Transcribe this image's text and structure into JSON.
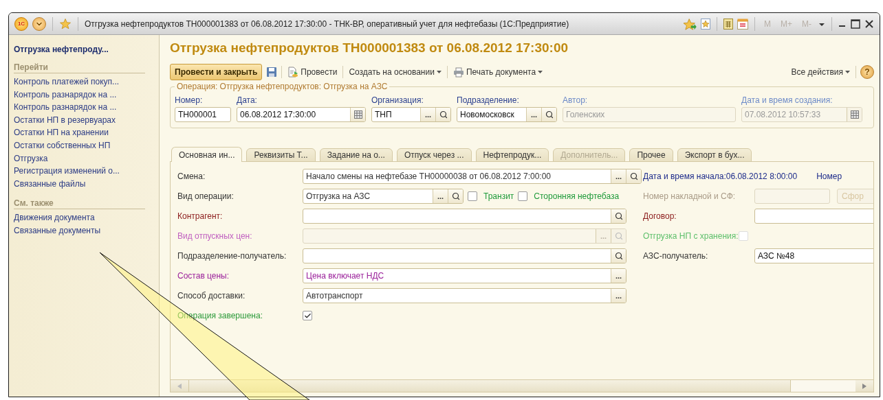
{
  "window": {
    "logo": "1С",
    "title": "Отгрузка нефтепродуктов ТН000001383 от 06.08.2012 17:30:00 - ТНК-ВР, оперативный учет для нефтебазы (1С:Предприятие)",
    "memory_buttons": [
      {
        "label": "M",
        "disabled": true
      },
      {
        "label": "M+",
        "disabled": true
      },
      {
        "label": "M-",
        "disabled": true
      }
    ]
  },
  "sidebar": {
    "title": "Отгрузка нефтепроду...",
    "sections": [
      {
        "heading": "Перейти",
        "items": [
          "Контроль платежей покуп...",
          "Контроль разнарядок на ...",
          "Контроль разнарядок на ...",
          "Остатки НП в резервуарах",
          "Остатки НП на хранении",
          "Остатки собственных НП",
          "Отгрузка",
          "Регистрация изменений о...",
          "Связанные файлы"
        ]
      },
      {
        "heading": "См. также",
        "items": [
          "Движения документа",
          "Связанные документы"
        ]
      }
    ]
  },
  "document": {
    "title": "Отгрузка нефтепродуктов ТН000001383 от 06.08.2012 17:30:00",
    "toolbar": [
      {
        "kind": "primary",
        "label": "Провести и закрыть"
      },
      {
        "kind": "save"
      },
      {
        "kind": "post",
        "label": "Провести"
      },
      {
        "kind": "dropdown",
        "label": "Создать на основании"
      },
      {
        "kind": "print",
        "label": "Печать документа"
      }
    ],
    "toolbar_right": [
      {
        "kind": "dropdown",
        "label": "Все действия"
      },
      {
        "kind": "help",
        "label": "?"
      }
    ],
    "operation": {
      "legend": "Операция: Отгрузка нефтепродуктов: Отгрузка на АЗС",
      "fields": [
        {
          "label": "Номер:",
          "color": "#2a3f8f",
          "value": "ТН000001"
        },
        {
          "label": "Дата:",
          "color": "#2a3f8f",
          "value": "06.08.2012 17:30:00",
          "buttons": [
            {
              "kind": "calendar"
            }
          ]
        },
        {
          "label": "Организация:",
          "color": "#2a3f8f",
          "value": "ТНП",
          "buttons": [
            {
              "kind": "choice",
              "label": "..."
            },
            {
              "kind": "search"
            }
          ]
        },
        {
          "label": "Подразделение:",
          "color": "#2a3f8f",
          "value": "Новомосковск",
          "buttons": [
            {
              "kind": "choice",
              "label": "..."
            },
            {
              "kind": "search"
            }
          ]
        },
        {
          "label": "Автор:",
          "color": "#6c8ac8",
          "value": "Голенских",
          "disabled": true
        },
        {
          "label": "Дата и время создания:",
          "color": "#6c8ac8",
          "value": "07.08.2012 10:57:33",
          "disabled": true,
          "buttons": [
            {
              "kind": "calendar"
            }
          ]
        }
      ]
    },
    "tabs": [
      {
        "label": "Основная ин...",
        "selected": true,
        "disabled": false
      },
      {
        "label": "Реквизиты Т...",
        "selected": false,
        "disabled": false
      },
      {
        "label": "Задание на о...",
        "selected": false,
        "disabled": false
      },
      {
        "label": "Отпуск через ...",
        "selected": false,
        "disabled": false
      },
      {
        "label": "Нефтепродук...",
        "selected": false,
        "disabled": false
      },
      {
        "label": "Дополнитель...",
        "selected": false,
        "disabled": true
      },
      {
        "label": "Прочее",
        "selected": false,
        "disabled": false
      },
      {
        "label": "Экспорт в бух...",
        "selected": false,
        "disabled": false
      }
    ],
    "rows": [
      {
        "label": "Смена:",
        "color": "#333333",
        "control": {
          "kind": "field",
          "value": "Начало смены на нефтебазе ТН00000038 от 06.08.2012 7:00:00",
          "buttons": [
            {
              "kind": "choice",
              "label": "..."
            },
            {
              "kind": "search"
            }
          ]
        },
        "aside": {
          "kind": "info",
          "label": "Дата и время начала:",
          "value": "06.08.2012 8:00:00",
          "extra": "Номер"
        }
      },
      {
        "label": "Вид операции:",
        "color": "#333333",
        "control": {
          "kind": "field",
          "value": "Отгрузка на АЗС",
          "buttons": [
            {
              "kind": "choice",
              "label": "..."
            },
            {
              "kind": "search"
            }
          ]
        },
        "checkboxes": [
          {
            "label": "Транзит",
            "checked": false
          },
          {
            "label": "Сторонняя нефтебаза",
            "checked": false
          }
        ],
        "aside": {
          "kind": "field",
          "label": "Номер накладной и СФ:",
          "color": "#a89a86",
          "disabled": true,
          "button": {
            "label": "Сфор",
            "disabled": true
          }
        }
      },
      {
        "label": "Контрагент:",
        "color": "#8b1a1a",
        "control": {
          "kind": "field",
          "buttons": [
            {
              "kind": "search"
            }
          ]
        },
        "aside": {
          "kind": "field",
          "label": "Договор:",
          "color": "#8b1a1a"
        }
      },
      {
        "label": "Вид отпускных цен:",
        "color": "#c060c0",
        "control": {
          "kind": "field",
          "disabled": true,
          "buttons": [
            {
              "kind": "choice",
              "label": "..."
            },
            {
              "kind": "search"
            }
          ]
        },
        "aside": {
          "kind": "checkbox",
          "label": "Отгрузка НП с хранения:",
          "color": "#5cbf6a",
          "checked": false,
          "disabled": true
        }
      },
      {
        "label": "Подразделение-получатель:",
        "color": "#333333",
        "control": {
          "kind": "field",
          "buttons": [
            {
              "kind": "search"
            }
          ]
        },
        "aside": {
          "kind": "field",
          "label": "АЗС-получатель:",
          "color": "#333333",
          "value": "АЗС №48"
        }
      },
      {
        "label": "Состав цены:",
        "color": "#9a1f9a",
        "control": {
          "kind": "field",
          "value": "Цена включает НДС",
          "buttons": [
            {
              "kind": "choice",
              "label": "..."
            }
          ]
        }
      },
      {
        "label": "Способ доставки:",
        "color": "#333333",
        "control": {
          "kind": "field",
          "value": "Автотранспорт",
          "buttons": [
            {
              "kind": "choice",
              "label": "..."
            }
          ]
        }
      },
      {
        "label": "Операция завершена:",
        "color": "#2c9a3a",
        "control": {
          "kind": "checkbox",
          "checked": true
        }
      }
    ]
  }
}
